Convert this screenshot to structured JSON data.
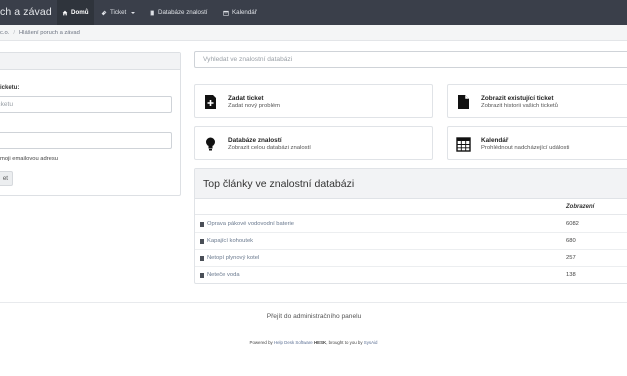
{
  "navbar": {
    "brand": "ch a závad",
    "items": [
      {
        "label": "Domů",
        "icon": "home-icon",
        "active": true
      },
      {
        "label": "Ticket",
        "icon": "ticket-icon",
        "active": false
      },
      {
        "label": "Databáze znalostí",
        "icon": "book-icon",
        "active": false
      },
      {
        "label": "Kalendář",
        "icon": "calendar-icon",
        "active": false
      }
    ]
  },
  "breadcrumb": {
    "items": [
      "c.o.",
      "Hlášení poruch a závad"
    ]
  },
  "left_panel": {
    "ticket_label": "icketu:",
    "ticket_placeholder": "ticketu",
    "email_checkbox_label": "moji emailovou adresu",
    "submit_label": "et"
  },
  "search": {
    "placeholder": "Vyhledat ve znalostní databázi"
  },
  "cards": [
    {
      "title": "Zadat ticket",
      "desc": "Zadat nový problém",
      "icon": "add-ticket-icon"
    },
    {
      "title": "Zobrazit existující ticket",
      "desc": "Zobrazit historii vašich ticketů",
      "icon": "document-icon"
    },
    {
      "title": "Databáze znalostí",
      "desc": "Zobrazit celou databázi znalostí",
      "icon": "lightbulb-icon"
    },
    {
      "title": "Kalendář",
      "desc": "Prohlédnout nadcházející události",
      "icon": "calendar-icon"
    }
  ],
  "articles": {
    "heading": "Top články ve znalostní databázi",
    "views_header": "Zobrazení",
    "rows": [
      {
        "title": "Oprava pákové vodovodní baterie",
        "views": "6082"
      },
      {
        "title": "Kapající kohoutek",
        "views": "680"
      },
      {
        "title": "Netopí plynový kotel",
        "views": "257"
      },
      {
        "title": "Neteče voda",
        "views": "138"
      }
    ]
  },
  "footer": {
    "admin_link": "Přejít do administračního panelu",
    "powered_prefix": "Powered by",
    "powered_link": "Help Desk Software",
    "powered_brand": "HESK",
    "powered_mid": ", brought to you by",
    "powered_sponsor": "SysAid"
  },
  "colors": {
    "navbar": "#3a3f4a",
    "navbar_active": "#2f343c",
    "panel_header": "#f2f3f5",
    "link": "#6b7a8f"
  }
}
